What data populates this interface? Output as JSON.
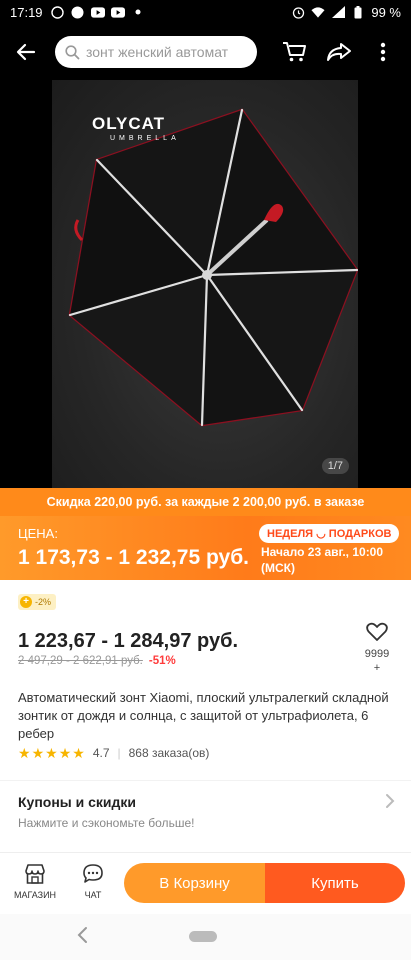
{
  "status_bar": {
    "time": "17:19",
    "battery": "99 %"
  },
  "search": {
    "placeholder": "зонт женский автомат"
  },
  "gallery": {
    "brand_name": "OLYCAT",
    "brand_sub": "UMBRELLA",
    "counter": "1/7"
  },
  "promo": {
    "banner_text": "Скидка 220,00 руб. за каждые 2 200,00 руб. в заказе",
    "price_label": "ЦЕНА:",
    "price_range": "1 173,73 - 1 232,75 руб.",
    "week_badge": "НЕДЕЛЯ ◡ ПОДАРКОВ",
    "start_date": "Начало 23 авг., 10:00 (МСК)"
  },
  "product": {
    "chip": "-2%",
    "price": "1 223,67 - 1 284,97 руб.",
    "old_price": "2 497,29 - 2 622,91 руб.",
    "discount": "-51%",
    "wishlist_count": "9999",
    "wishlist_plus": "+",
    "title": "Автоматический зонт Xiaomi, плоский ультралегкий складной зонтик от дождя и солнца, с защитой от ультрафиолета, 6 ребер",
    "rating": "4.7",
    "orders": "868 заказа(ов)",
    "rating_fill": 0.94
  },
  "coupons": {
    "title": "Купоны и скидки",
    "subtitle": "Нажмите и сэкономьте больше!"
  },
  "actions": {
    "store_label": "МАГАЗИН",
    "chat_label": "ЧАТ",
    "cart_label": "В Корзину",
    "buy_label": "Купить"
  },
  "colors": {
    "accent_orange": "#ff9a2a",
    "buy_red": "#ff5a1f",
    "discount_red": "#ff3b3b",
    "star": "#f7b500"
  },
  "icons": [
    "back-arrow-icon",
    "search-icon",
    "cart-icon",
    "share-icon",
    "more-icon",
    "heart-icon",
    "chevron-right-icon",
    "store-icon",
    "chat-icon"
  ]
}
